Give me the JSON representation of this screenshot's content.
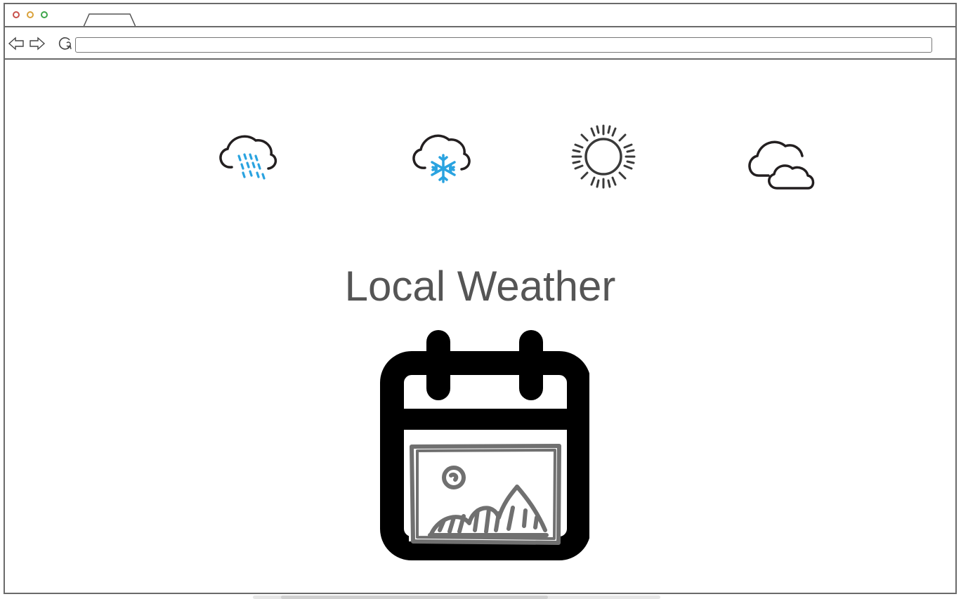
{
  "browser": {
    "address_value": ""
  },
  "page": {
    "title": "Local Weather"
  },
  "icons": {
    "weather": [
      "rain-cloud-icon",
      "snow-cloud-icon",
      "sun-icon",
      "partly-cloudy-icon"
    ],
    "calendar": "calendar-image-icon"
  },
  "colors": {
    "title": "#555555",
    "precipitation": "#2aa3e0",
    "outline": "#231f20",
    "sun": "#3a3a3a"
  }
}
